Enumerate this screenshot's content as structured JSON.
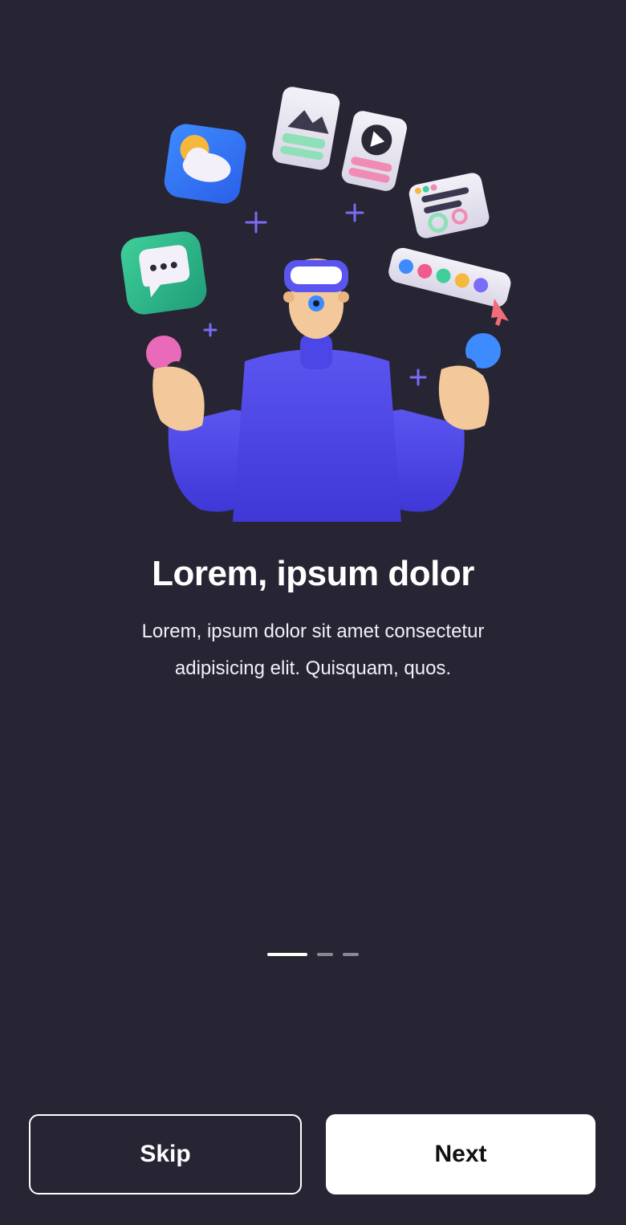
{
  "onboarding": {
    "title": "Lorem, ipsum dolor",
    "description_line1": "Lorem, ipsum dolor sit amet consectetur",
    "description_line2": "adipisicing elit. Quisquam, quos.",
    "current_page": 1,
    "total_pages": 3
  },
  "actions": {
    "skip_label": "Skip",
    "next_label": "Next"
  },
  "illustration": {
    "icons": [
      "weather-icon",
      "image-card-icon",
      "video-card-icon",
      "chat-icon",
      "ui-panel-icon",
      "color-palette-icon",
      "vr-headset-icon",
      "cursor-icon"
    ]
  },
  "colors": {
    "background": "#272534",
    "accent": "#5249e0",
    "text": "#ffffff"
  }
}
